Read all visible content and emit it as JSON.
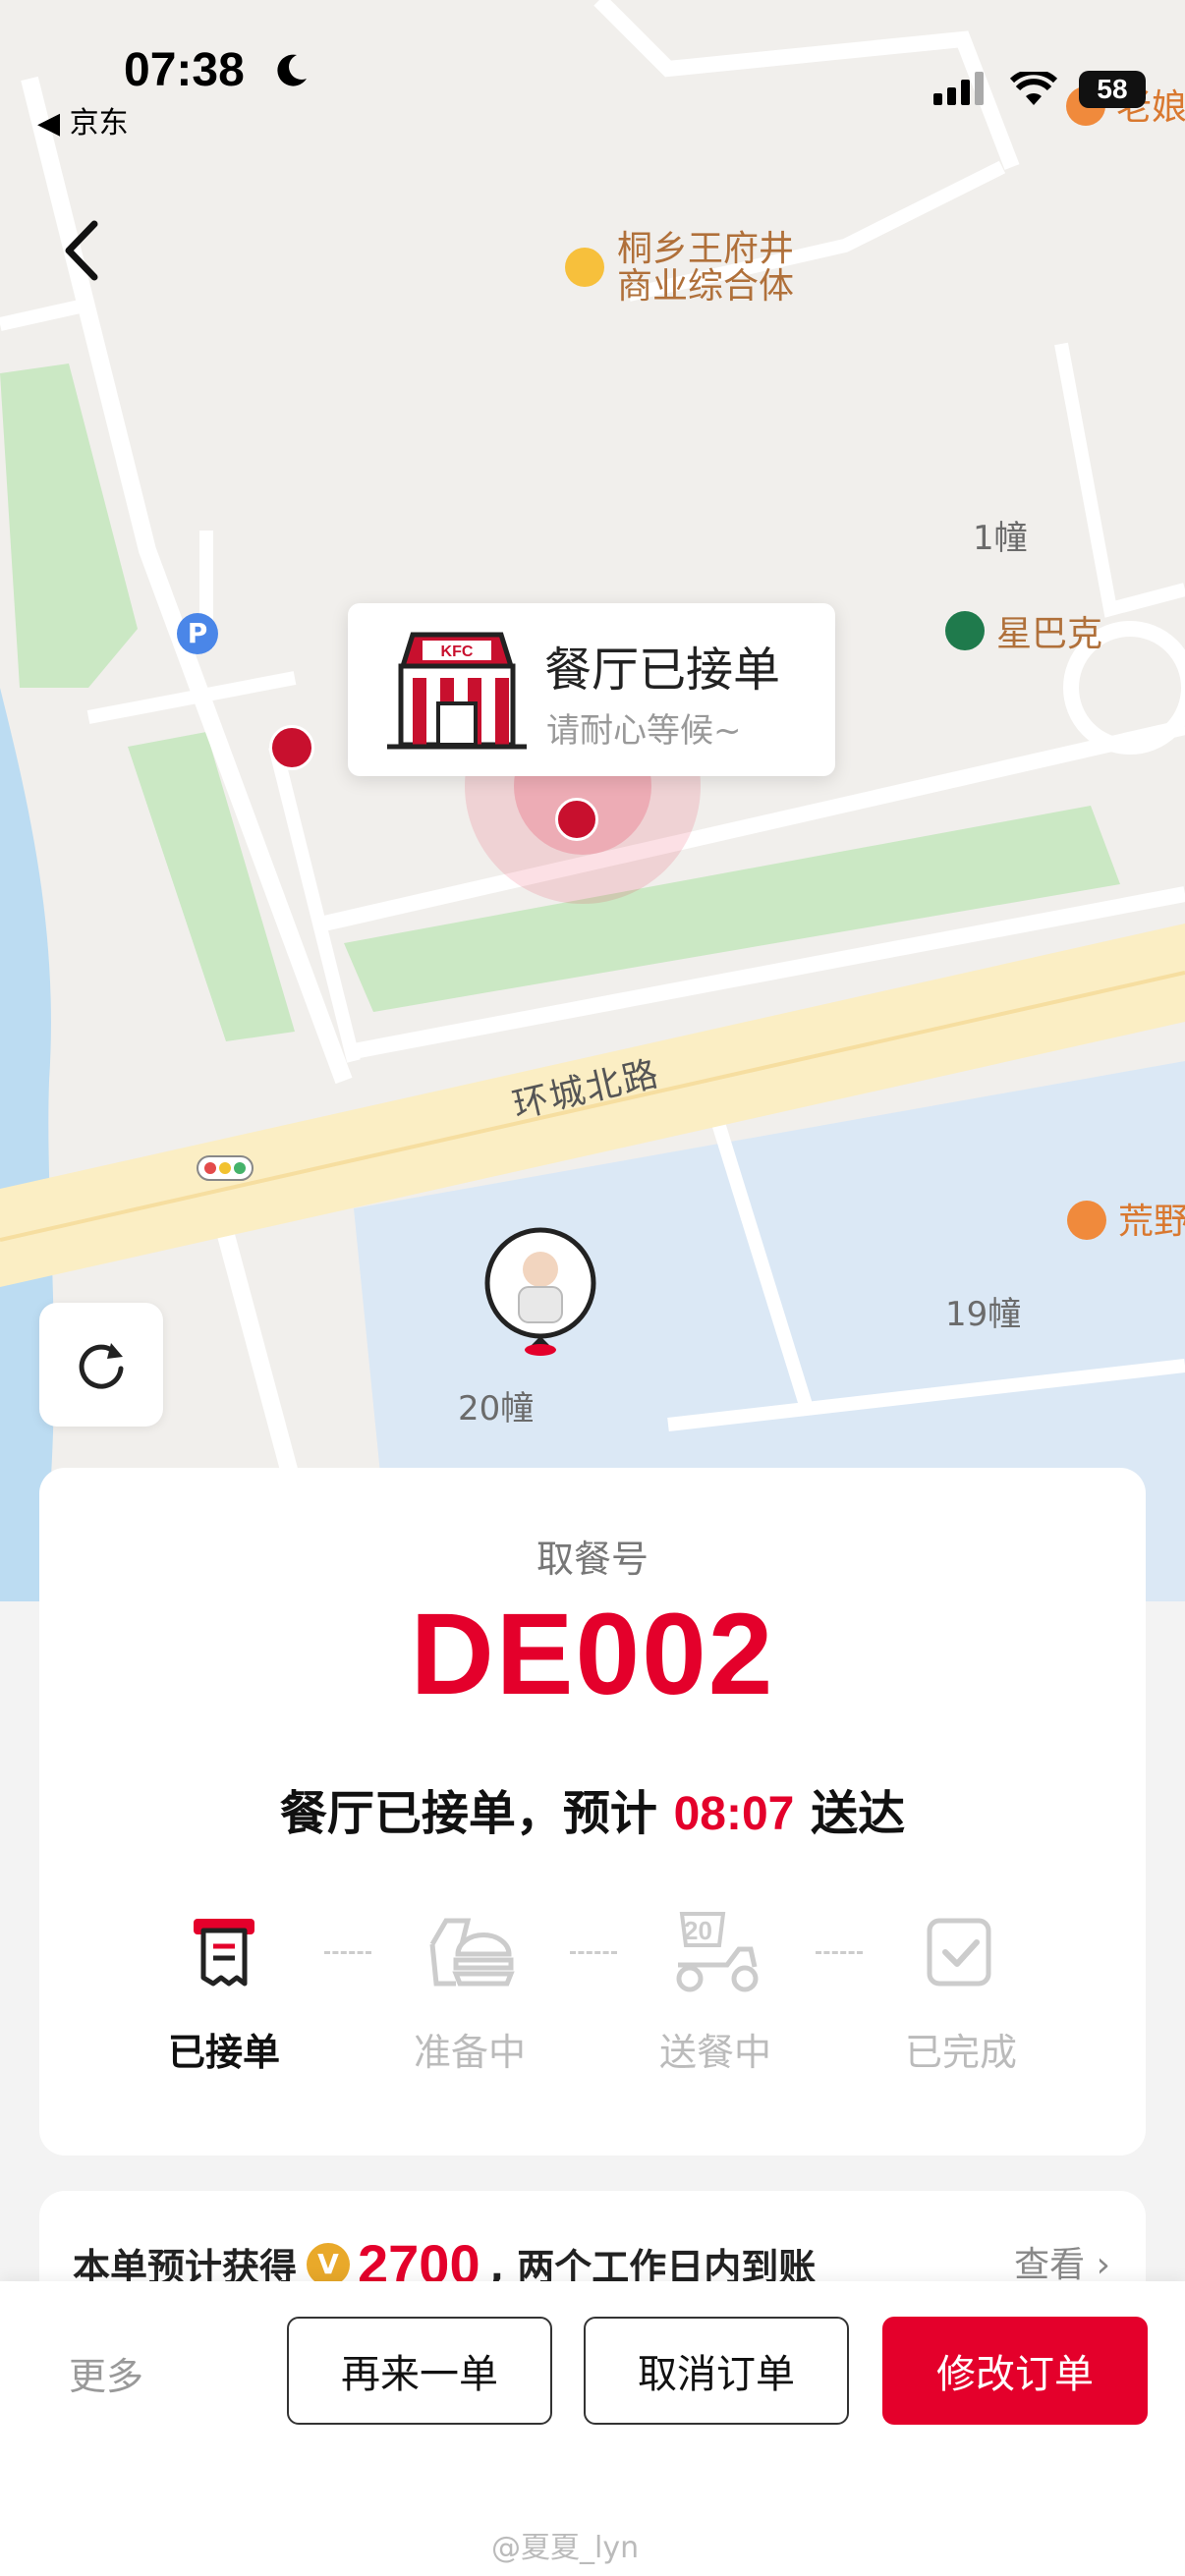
{
  "status_bar": {
    "time": "07:38",
    "back_app": "◀ 京东",
    "battery": "58"
  },
  "map": {
    "labels": {
      "laoniang": "老娘",
      "mall_line1": "桐乡王府井",
      "mall_line2": "商业综合体",
      "building_1": "1幢",
      "starbucks": "星巴克",
      "road": "环城北路",
      "huangye": "荒野",
      "building_19": "19幢",
      "building_20": "20幢"
    },
    "restaurant_bubble": {
      "title": "餐厅已接单",
      "subtitle": "请耐心等候~"
    }
  },
  "order": {
    "pickup_label": "取餐号",
    "pickup_code": "DE002",
    "eta_prefix": "餐厅已接单，预计 ",
    "eta_time": "08:07",
    "eta_suffix": " 送达",
    "steps": [
      {
        "label": "已接单",
        "icon": "receipt-icon",
        "active": true
      },
      {
        "label": "准备中",
        "icon": "burger-icon",
        "active": false
      },
      {
        "label": "送餐中",
        "icon": "scooter-icon",
        "active": false
      },
      {
        "label": "已完成",
        "icon": "check-box-icon",
        "active": false
      }
    ]
  },
  "reward": {
    "prefix": "本单预计获得",
    "coin_symbol": "V",
    "amount": "2700",
    "suffix": ", 两个工作日内到账",
    "view_label": "查看 ›"
  },
  "bottom_bar": {
    "more_label": "更多",
    "reorder_label": "再来一单",
    "cancel_label": "取消订单",
    "modify_label": "修改订单"
  },
  "watermark": "@夏夏_lyn",
  "colors": {
    "brand_red": "#e4002b",
    "coin": "#e9a92a"
  }
}
